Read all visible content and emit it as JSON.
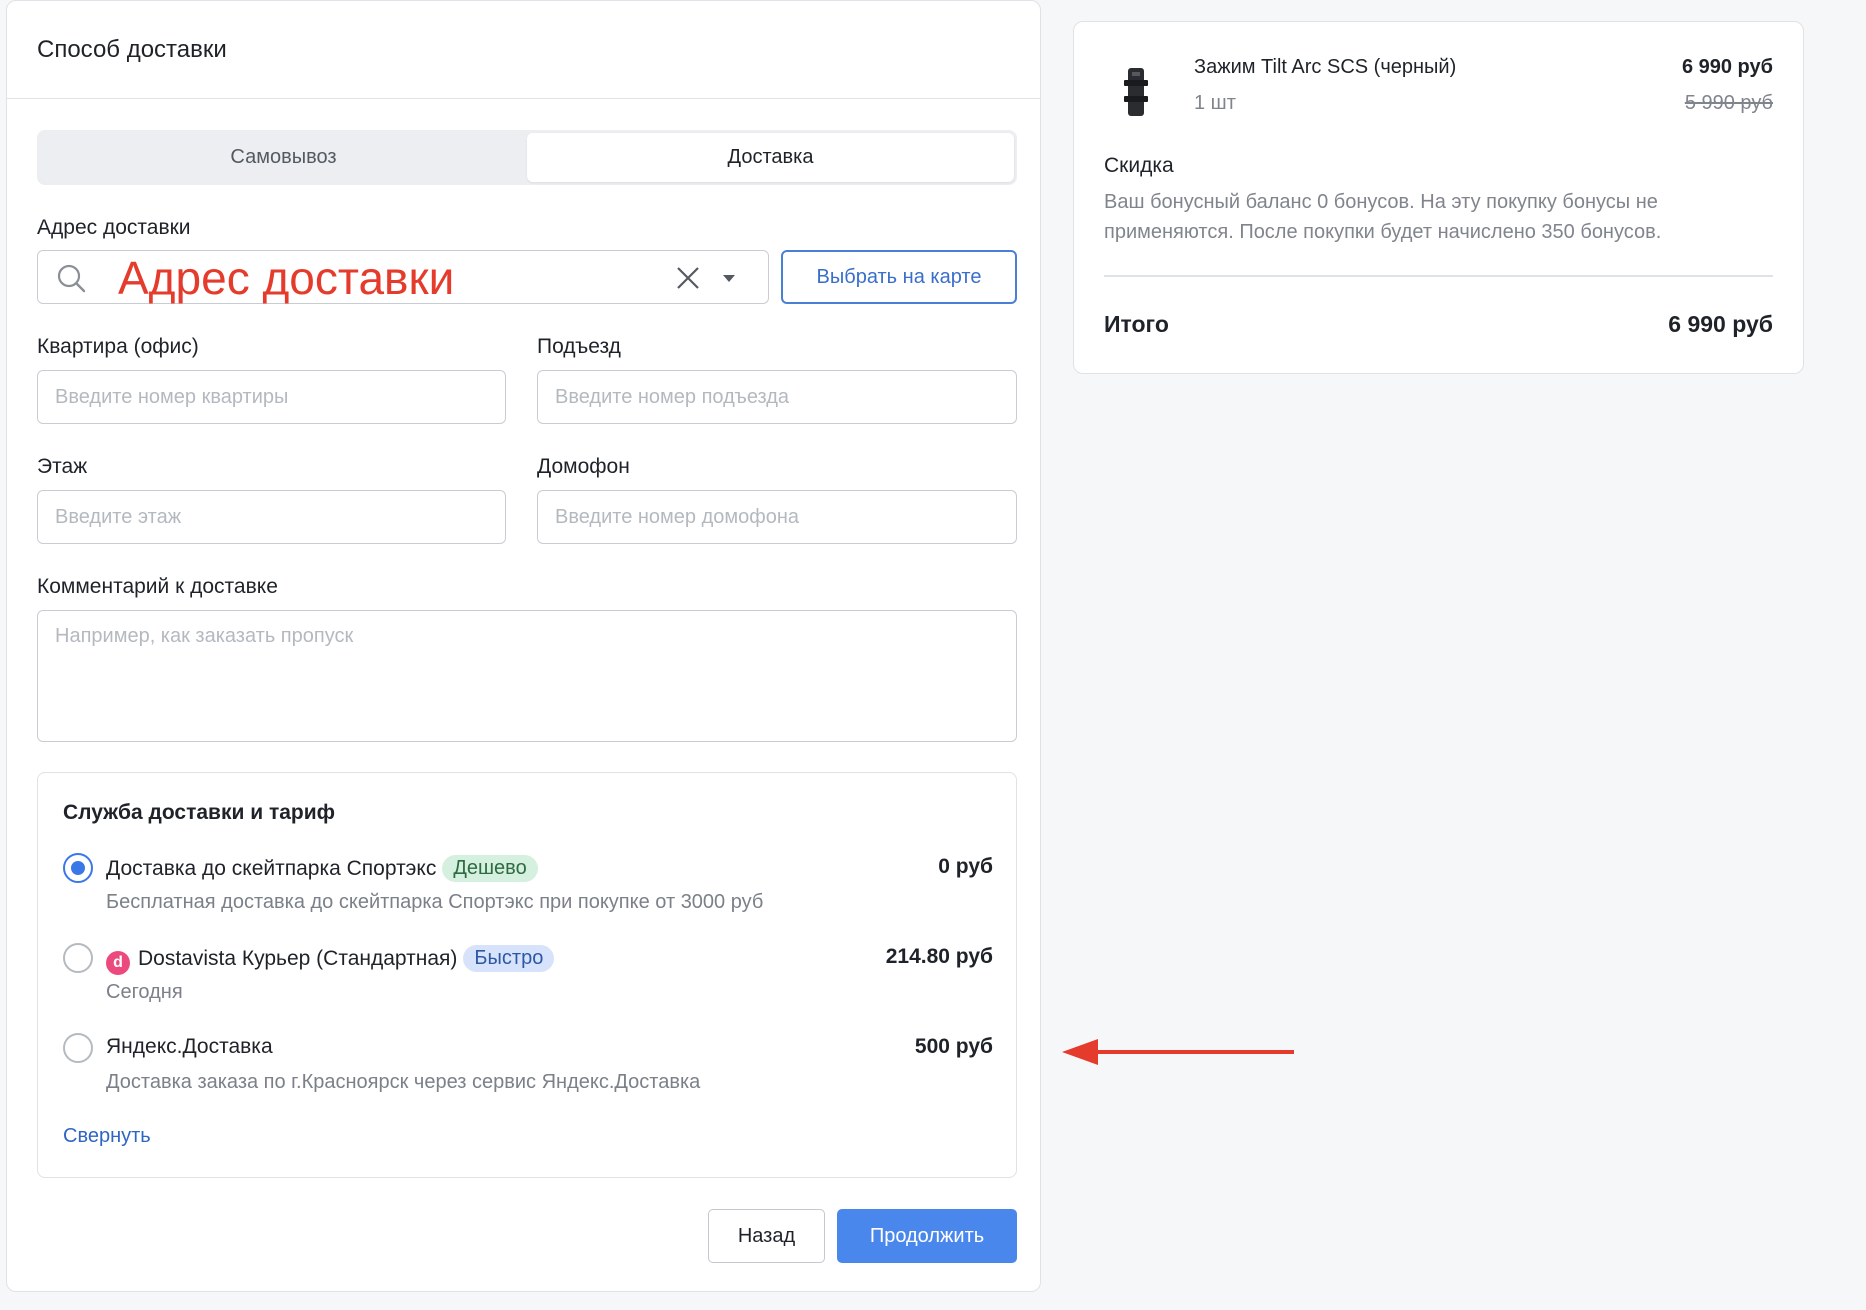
{
  "header": {
    "title": "Способ доставки"
  },
  "tabs": [
    {
      "label": "Самовывоз",
      "active": false
    },
    {
      "label": "Доставка",
      "active": true
    }
  ],
  "address": {
    "label": "Адрес доставки",
    "value": "Адрес доставки",
    "map_button": "Выбрать на карте",
    "icons": [
      "search-icon",
      "close-icon",
      "caret-down-icon"
    ]
  },
  "fields": {
    "apartment": {
      "label": "Квартира (офис)",
      "placeholder": "Введите номер квартиры"
    },
    "entrance": {
      "label": "Подъезд",
      "placeholder": "Введите номер подъезда"
    },
    "floor": {
      "label": "Этаж",
      "placeholder": "Введите этаж"
    },
    "intercom": {
      "label": "Домофон",
      "placeholder": "Введите номер домофона"
    },
    "comment": {
      "label": "Комментарий к доставке",
      "placeholder": "Например, как заказать пропуск"
    }
  },
  "service": {
    "title": "Служба доставки и тариф",
    "options": [
      {
        "name": "Доставка до скейтпарка Спортэкс",
        "badge": "Дешево",
        "badge_color": "green",
        "desc": "Бесплатная доставка до скейтпарка Спортэкс при покупке от 3000 руб",
        "price": "0 руб",
        "selected": true
      },
      {
        "logo": "d",
        "name": "Dostavista Курьер (Стандартная)",
        "badge": "Быстро",
        "badge_color": "blue",
        "desc": "Сегодня",
        "price": "214.80 руб",
        "selected": false
      },
      {
        "name": "Яндекс.Доставка",
        "desc": "Доставка заказа по г.Красноярск через сервис Яндекс.Доставка",
        "price": "500 руб",
        "selected": false
      }
    ],
    "collapse_label": "Свернуть"
  },
  "actions": {
    "back_label": "Назад",
    "next_label": "Продолжить"
  },
  "summary": {
    "product": {
      "name": "Зажим Tilt Arc SCS (черный)",
      "qty": "1 шт",
      "price": "6 990 руб",
      "old_price": "5 990 руб"
    },
    "discount_title": "Скидка",
    "discount_text": "Ваш бонусный баланс 0 бонусов. На эту покупку бонусы не применяются. После покупки будет начислено 350 бонусов.",
    "total_label": "Итого",
    "total_value": "6 990 руб"
  },
  "colors": {
    "accent": "#4a87ec",
    "annotation": "#e53b2c",
    "badge_green": "#d6f0df",
    "badge_blue": "#d6e3fa"
  }
}
